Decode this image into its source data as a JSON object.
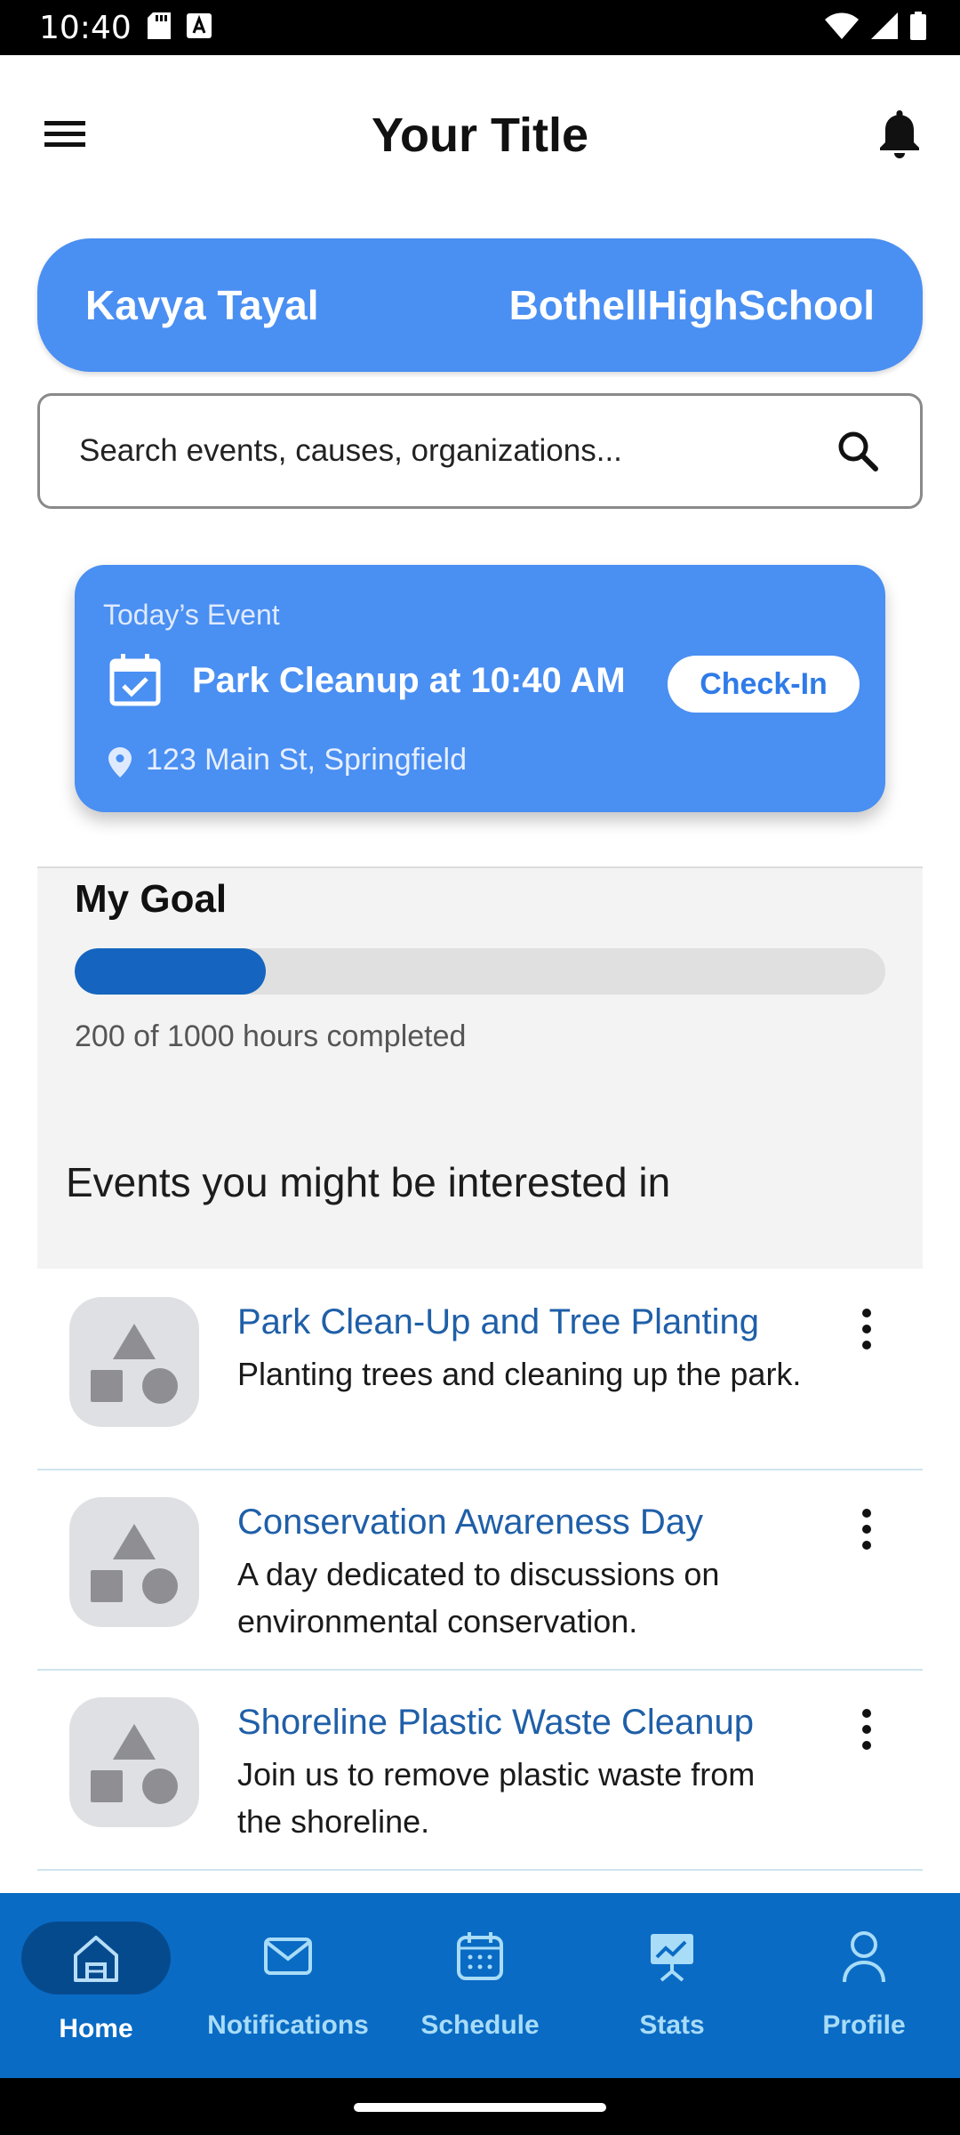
{
  "status_bar": {
    "time": "10:40"
  },
  "app_bar": {
    "title": "Your Title",
    "icons": {
      "menu": "hamburger-menu-icon",
      "notifications": "bell-icon"
    }
  },
  "user": {
    "name": "Kavya Tayal",
    "school": "BothellHighSchool"
  },
  "search": {
    "placeholder": "Search events, causes, organizations...",
    "value": ""
  },
  "today_event": {
    "tag": "Today’s Event",
    "title": "Park Cleanup at 10:40 AM",
    "checkin_label": "Check-In",
    "address": "123 Main St, Springfield"
  },
  "goal": {
    "title": "My Goal",
    "completed": 200,
    "total": 1000,
    "progress_fraction": 0.2,
    "progress_text": "200 of 1000 hours completed"
  },
  "interested": {
    "title": "Events you might be interested in",
    "items": [
      {
        "title": "Park Clean-Up and Tree Planting",
        "description": "Planting trees and cleaning up the park."
      },
      {
        "title": "Conservation Awareness Day",
        "description": "A day dedicated to discussions on environmental conservation."
      },
      {
        "title": "Shoreline Plastic Waste Cleanup",
        "description": "Join us to remove plastic waste from the shoreline."
      }
    ]
  },
  "bottom_nav": {
    "items": [
      {
        "label": "Home",
        "icon": "home-icon",
        "active": true
      },
      {
        "label": "Notifications",
        "icon": "mail-icon",
        "active": false
      },
      {
        "label": "Schedule",
        "icon": "calendar-icon",
        "active": false
      },
      {
        "label": "Stats",
        "icon": "stats-presentation-icon",
        "active": false
      },
      {
        "label": "Profile",
        "icon": "person-icon",
        "active": false
      }
    ]
  },
  "colors": {
    "primary": "#4a8ff2",
    "nav_bg": "#0a6bc4",
    "progress": "#1565c0",
    "link": "#1f5fa8"
  }
}
